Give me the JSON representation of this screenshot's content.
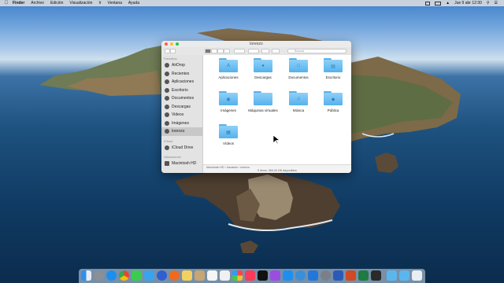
{
  "menubar": {
    "app": "Finder",
    "items": [
      "Archivo",
      "Edición",
      "Visualización",
      "Ir",
      "Ventana",
      "Ayuda"
    ],
    "clock": "Jue 9 abr 12:30"
  },
  "window": {
    "title": "lorenzo",
    "search_placeholder": "Buscar",
    "sidebar": {
      "favorites_header": "Favoritos",
      "favorites": [
        "AirDrop",
        "Recientes",
        "Aplicaciones",
        "Escritorio",
        "Documentos",
        "Descargas",
        "Videos",
        "Imágenes",
        "lorenzo"
      ],
      "icloud_header": "iCloud",
      "icloud": [
        "iCloud Drive"
      ],
      "locations_header": "Ubicaciones",
      "locations": [
        "Macintosh HD"
      ]
    },
    "items": [
      "Aplicaciones",
      "Descargas",
      "Documentos",
      "Escritorio",
      "Imágenes",
      "Máquinas virtuales",
      "Música",
      "Pública",
      "Vídeos"
    ],
    "pathbar": "Macintosh HD  ›  Usuarios  ›  lorenzo",
    "status": "9 ítems, 369,43 GB disponibles"
  },
  "dock": {
    "icons": [
      "finder-icon",
      "launchpad-icon",
      "safari-icon",
      "chrome-icon",
      "messages-icon",
      "mail-icon",
      "firefox-icon",
      "notes-icon",
      "calendar-icon",
      "photos-icon",
      "reminders-icon",
      "music-icon",
      "tv-icon",
      "podcasts-icon",
      "appstore-icon",
      "word-icon",
      "excel-icon",
      "terminal-icon",
      "settings-icon",
      "downloads-folder-icon",
      "folder-icon",
      "trash-icon"
    ]
  },
  "colors": {
    "folder": "#55b2ec",
    "accent": "#0a84ff"
  }
}
